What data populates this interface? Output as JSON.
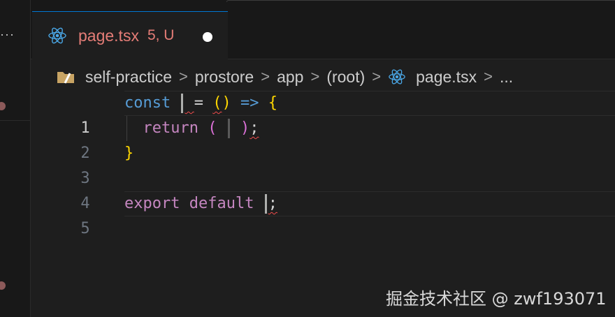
{
  "left_panel": {
    "more_label": "···",
    "scm_markers": [
      "modified-dot",
      "modified-dot"
    ]
  },
  "tab": {
    "icon": "react-icon",
    "title": "page.tsx",
    "status": "5, U",
    "dirty_indicator": "unsaved-dot",
    "accent_color": "#0078d4",
    "title_color": "#e57d77"
  },
  "breadcrumb": {
    "items": [
      {
        "label": "self-practice",
        "icon": "folder-icon"
      },
      {
        "label": "prostore"
      },
      {
        "label": "app"
      },
      {
        "label": "(root)"
      },
      {
        "label": "page.tsx",
        "icon": "react-icon"
      },
      {
        "label": "..."
      }
    ],
    "separator": ">"
  },
  "editor": {
    "lines": [
      {
        "number": "1",
        "tokens": [
          "const",
          "=",
          "(",
          ")",
          "=>",
          "{"
        ]
      },
      {
        "number": "2",
        "tokens": [
          "return",
          "(",
          ")",
          ";"
        ]
      },
      {
        "number": "3",
        "tokens": [
          "}"
        ]
      },
      {
        "number": "4",
        "tokens": []
      },
      {
        "number": "5",
        "tokens": [
          "export",
          "default",
          ";"
        ]
      }
    ]
  },
  "watermark": "掘金技术社区 @ zwf193071",
  "colors": {
    "background": "#1e1e1e",
    "keyword_blue": "#569cd6",
    "keyword_purple": "#c586c0",
    "bracket_yellow": "#ffd700",
    "bracket_purple": "#da70d6",
    "error_squiggle": "#f14c4c"
  }
}
